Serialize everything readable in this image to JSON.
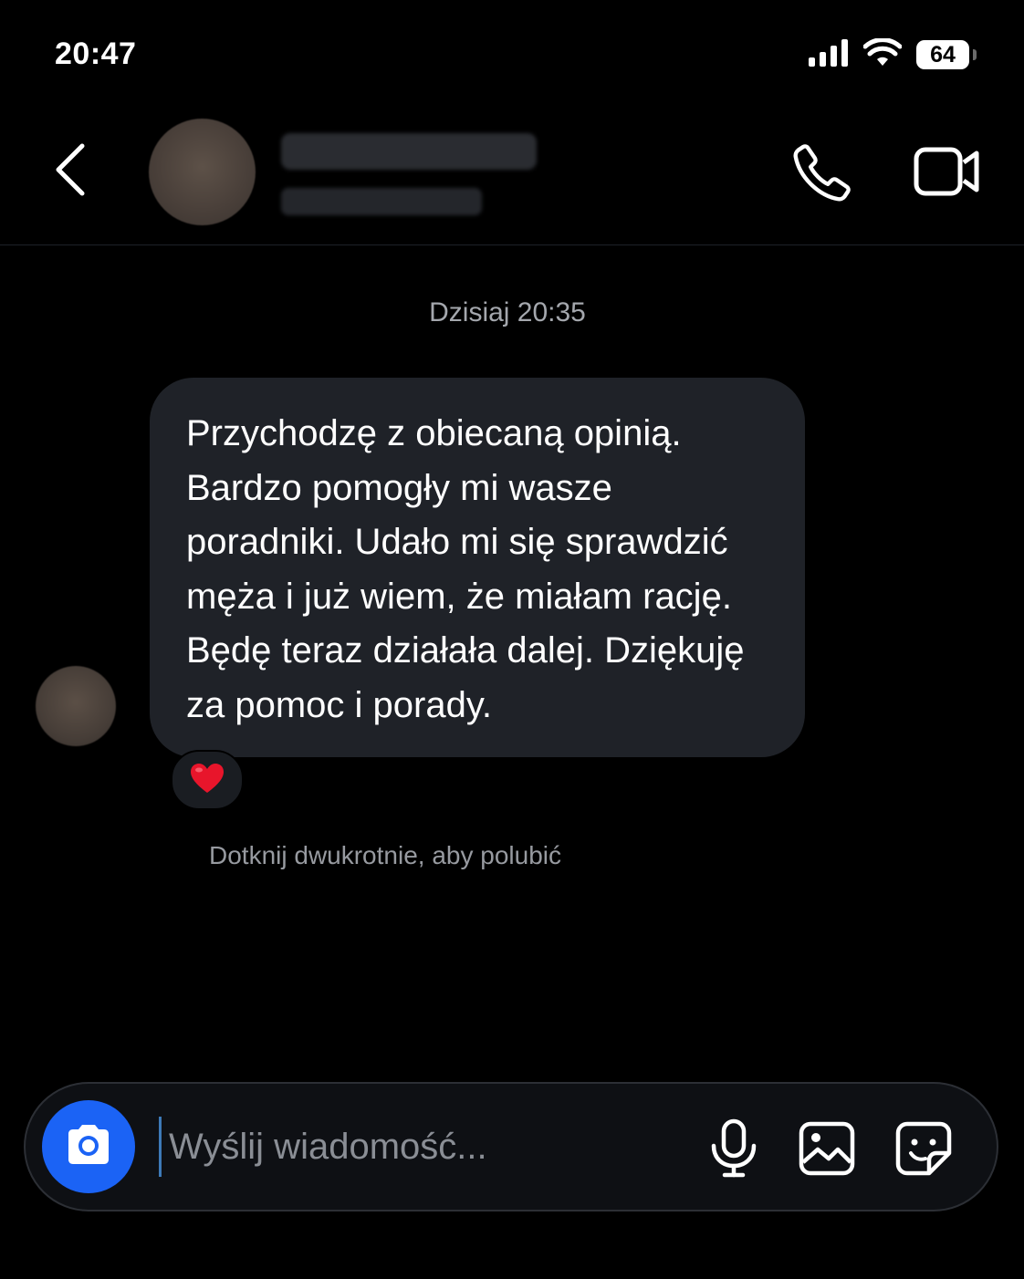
{
  "status_bar": {
    "time": "20:47",
    "battery": "64"
  },
  "header": {
    "back_icon": "chevron-left-icon",
    "call_icon": "phone-icon",
    "video_icon": "video-camera-icon"
  },
  "conversation": {
    "timestamp": "Dzisiaj 20:35",
    "messages": [
      {
        "text": "Przychodzę z obiecaną opinią.\nBardzo pomogły mi wasze\nporadniki. Udało mi się sprawdzić\nmęża i już wiem, że miałam rację.\nBędę teraz działała dalej. Dziękuję\nza pomoc i porady.",
        "reaction": "❤️"
      }
    ],
    "hint": "Dotknij dwukrotnie, aby polubić"
  },
  "composer": {
    "placeholder": "Wyślij wiadomość...",
    "value": "",
    "camera_icon": "camera-icon",
    "mic_icon": "microphone-icon",
    "gallery_icon": "image-gallery-icon",
    "sticker_icon": "sticker-icon",
    "accent_color": "#1b63f5"
  },
  "colors": {
    "background": "#000000",
    "bubble": "#1f2228",
    "secondary_text": "#a4a7ad"
  }
}
